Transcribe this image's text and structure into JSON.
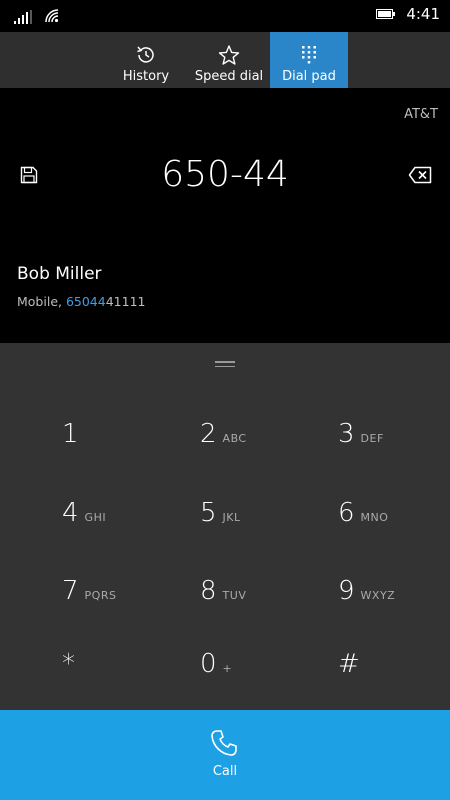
{
  "status_bar": {
    "time": "4:41"
  },
  "tabs": [
    {
      "label": "History",
      "icon": "history-icon",
      "active": false
    },
    {
      "label": "Speed dial",
      "icon": "star-icon",
      "active": false
    },
    {
      "label": "Dial pad",
      "icon": "dialpad-icon",
      "active": true
    }
  ],
  "number_panel": {
    "carrier": "AT&T",
    "number": "650-44",
    "contact": {
      "name": "Bob Miller",
      "type_label": "Mobile, ",
      "number_match": "65044",
      "number_rest": "41111"
    }
  },
  "keypad": {
    "keys": [
      {
        "digit": "1",
        "letters": ""
      },
      {
        "digit": "2",
        "letters": "ABC"
      },
      {
        "digit": "3",
        "letters": "DEF"
      },
      {
        "digit": "4",
        "letters": "GHI"
      },
      {
        "digit": "5",
        "letters": "JKL"
      },
      {
        "digit": "6",
        "letters": "MNO"
      },
      {
        "digit": "7",
        "letters": "PQRS"
      },
      {
        "digit": "8",
        "letters": "TUV"
      },
      {
        "digit": "9",
        "letters": "WXYZ"
      },
      {
        "digit": "*",
        "letters": ""
      },
      {
        "digit": "0",
        "letters": "+"
      },
      {
        "digit": "#",
        "letters": ""
      }
    ]
  },
  "call": {
    "label": "Call"
  },
  "colors": {
    "accent": "#2b86c9",
    "call_bar": "#1ea0e4",
    "keypad_bg": "#333333",
    "tabs_bg": "#2f2f2f",
    "match_highlight": "#3da0e6"
  }
}
